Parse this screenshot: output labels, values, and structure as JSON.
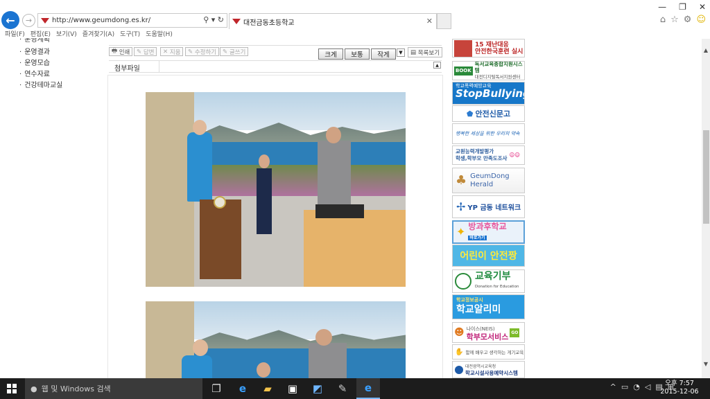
{
  "browser": {
    "url": "http://www.geumdong.es.kr/",
    "tab_title": "대전금동초등학교",
    "menu": [
      "파일(F)",
      "편집(E)",
      "보기(V)",
      "즐겨찾기(A)",
      "도구(T)",
      "도움말(H)"
    ]
  },
  "sidebar_nav": [
    "운영계획",
    "운영결과",
    "운영모습",
    "연수자료",
    "건강테마교실"
  ],
  "board_toolbar": {
    "print": "인쇄",
    "reply": "답변",
    "delete": "지움",
    "edit": "수정하기",
    "write": "글쓰기",
    "size_large": "크게",
    "size_normal": "보통",
    "size_small": "작게",
    "list": "목록보기"
  },
  "attachment_label": "첨부파일",
  "banners": [
    {
      "line1": "15 재난대응",
      "line2": "안전한국훈련 실시"
    },
    {
      "tag": "BOOK",
      "line1": "독서교육종합지원시스템",
      "line2": "대전디지털독서지원센터"
    },
    {
      "line1": "학교폭력예방교육",
      "line2": "StopBullying"
    },
    {
      "line1": "안전신문고"
    },
    {
      "line1": "행복한 세상을 위한 우리의 약속"
    },
    {
      "line1": "교원능력개발평가",
      "line2": "학생,학부모 만족도조사"
    },
    {
      "line1": "GeumDong",
      "line2": "Herald"
    },
    {
      "line1": "YP 금동 네트워크"
    },
    {
      "line1": "방과후학교",
      "line2": "바로가기"
    },
    {
      "line1": "어린이 안전짱"
    },
    {
      "line1": "교육기부",
      "line2": "Donation for Education"
    },
    {
      "line1": "학교정보공시",
      "line2": "학교알리미"
    },
    {
      "line1": "나이스(NEIS)",
      "line2": "학부모서비스",
      "badge": "GO"
    },
    {
      "line1": "함께 배우고 생각하는 게기교육"
    },
    {
      "line1": "대전광역시교육청",
      "line2": "학교시설사용예약시스템"
    }
  ],
  "taskbar": {
    "search_placeholder": "웹 및 Windows 검색",
    "time": "오후 7:57",
    "date": "2015-12-06"
  }
}
